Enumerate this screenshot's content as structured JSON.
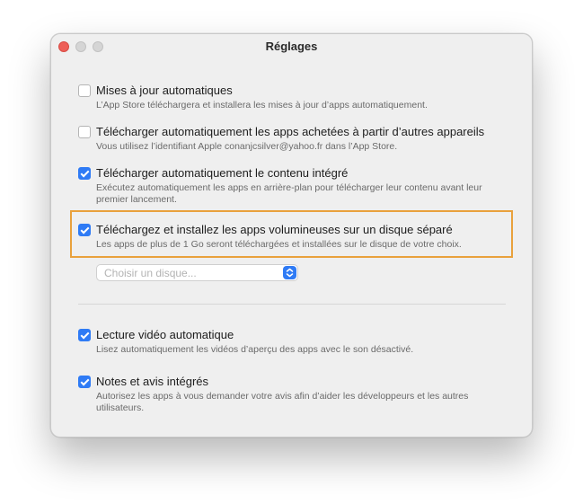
{
  "window": {
    "title": "Réglages"
  },
  "options": [
    {
      "label": "Mises à jour automatiques",
      "description": "L’App Store téléchargera et installera les mises à jour d’apps automatiquement.",
      "checked": false
    },
    {
      "label": "Télécharger automatiquement les apps achetées à partir d’autres appareils",
      "description": "Vous utilisez l’identifiant Apple conanjcsilver@yahoo.fr dans l’App Store.",
      "checked": false
    },
    {
      "label": "Télécharger automatiquement le contenu intégré",
      "description": "Exécutez automatiquement les apps en arrière-plan pour télécharger leur contenu avant leur premier lancement.",
      "checked": true
    },
    {
      "label": "Téléchargez et installez les apps volumineuses sur un disque séparé",
      "description": "Les apps de plus de 1 Go seront téléchargées et installées sur le disque de votre choix.",
      "checked": true
    },
    {
      "label": "Lecture vidéo automatique",
      "description": "Lisez automatiquement les vidéos d’aperçu des apps avec le son désactivé.",
      "checked": true
    },
    {
      "label": "Notes et avis intégrés",
      "description": "Autorisez les apps à vous demander votre avis afin d’aider les développeurs et les autres utilisateurs.",
      "checked": true
    }
  ],
  "disk_select": {
    "placeholder": "Choisir un disque..."
  },
  "colors": {
    "accent": "#2f7bf5",
    "highlight": "#e9a13c",
    "close_button": "#ee5f58"
  }
}
